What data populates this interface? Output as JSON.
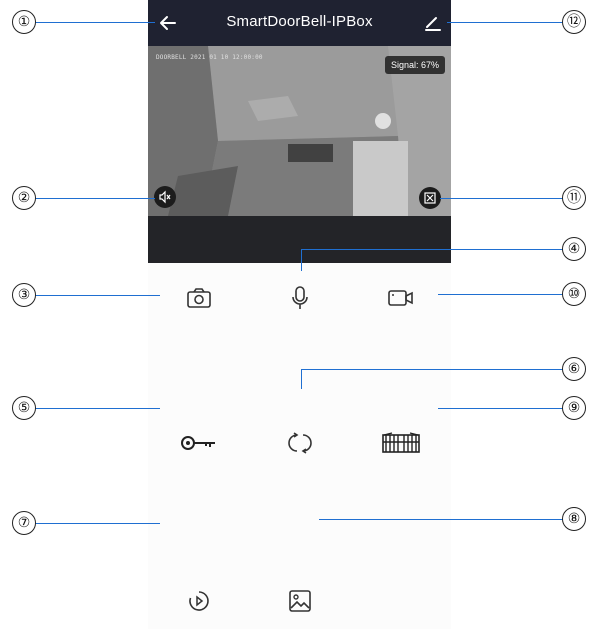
{
  "header": {
    "title": "SmartDoorBell-IPBox",
    "back_icon": "arrow-left-icon",
    "edit_icon": "pencil-icon",
    "background": "#1f2231"
  },
  "video": {
    "osd_text": "DOORBELL 2021 01 10 12:00:00",
    "signal_text": "Signal: 67%",
    "mute_icon": "speaker-mute-icon",
    "fullscreen_icon": "fullscreen-icon"
  },
  "controls": {
    "snapshot_icon": "camera-icon",
    "talk_icon": "microphone-icon",
    "record_icon": "video-record-icon",
    "unlock_icon": "key-icon",
    "switch_icon": "refresh-icon",
    "gate_icon": "gate-icon",
    "playback_icon": "playback-icon",
    "album_icon": "image-icon"
  },
  "callouts": [
    "①",
    "②",
    "③",
    "④",
    "⑤",
    "⑥",
    "⑦",
    "⑧",
    "⑨",
    "⑩",
    "⑪",
    "⑫"
  ],
  "accent": "#1f6fd1"
}
